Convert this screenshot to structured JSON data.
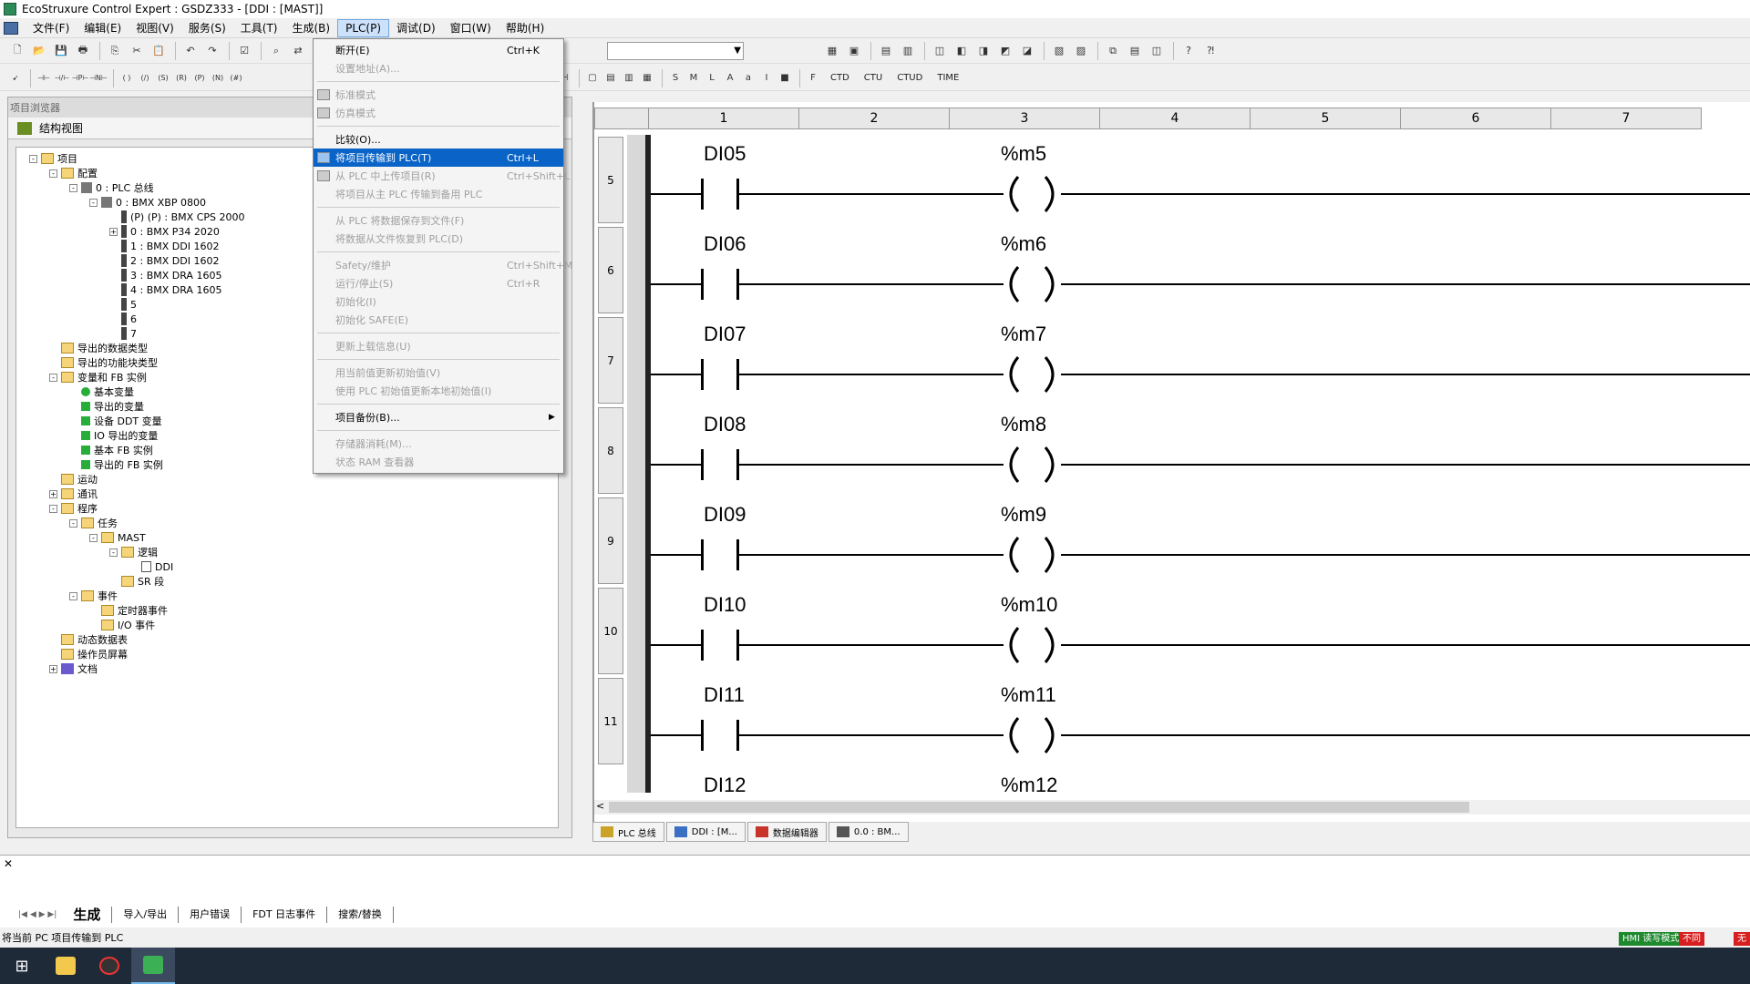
{
  "window": {
    "title": "EcoStruxure Control Expert : GSDZ333 - [DDI : [MAST]]"
  },
  "menubar": {
    "items": [
      "文件(F)",
      "编辑(E)",
      "视图(V)",
      "服务(S)",
      "工具(T)",
      "生成(B)",
      "PLC(P)",
      "调试(D)",
      "窗口(W)",
      "帮助(H)"
    ]
  },
  "toolbar2": {
    "blocks": [
      "CTD",
      "CTU",
      "CTUD",
      "TIME"
    ]
  },
  "browser": {
    "title": "项目浏览器",
    "view_tab": "结构视图",
    "tree": [
      {
        "label": "项目",
        "expand": "-",
        "indent": 0,
        "icon": "folder"
      },
      {
        "label": "配置",
        "expand": "-",
        "indent": 1,
        "icon": "folder"
      },
      {
        "label": "0 : PLC 总线",
        "expand": "-",
        "indent": 2,
        "icon": "rack"
      },
      {
        "label": "0 : BMX XBP 0800",
        "expand": "-",
        "indent": 3,
        "icon": "rack"
      },
      {
        "label": "(P) (P) : BMX CPS 2000",
        "expand": "",
        "indent": 4,
        "icon": "card"
      },
      {
        "label": "0 : BMX P34 2020",
        "expand": "+",
        "indent": 4,
        "icon": "card"
      },
      {
        "label": "1 : BMX DDI 1602",
        "expand": "",
        "indent": 4,
        "icon": "card"
      },
      {
        "label": "2 : BMX DDI 1602",
        "expand": "",
        "indent": 4,
        "icon": "card"
      },
      {
        "label": "3 : BMX DRA 1605",
        "expand": "",
        "indent": 4,
        "icon": "card"
      },
      {
        "label": "4 : BMX DRA 1605",
        "expand": "",
        "indent": 4,
        "icon": "card"
      },
      {
        "label": "5",
        "expand": "",
        "indent": 4,
        "icon": "card"
      },
      {
        "label": "6",
        "expand": "",
        "indent": 4,
        "icon": "card"
      },
      {
        "label": "7",
        "expand": "",
        "indent": 4,
        "icon": "card"
      },
      {
        "label": "导出的数据类型",
        "expand": "",
        "indent": 1,
        "icon": "folder"
      },
      {
        "label": "导出的功能块类型",
        "expand": "",
        "indent": 1,
        "icon": "folder"
      },
      {
        "label": "变量和 FB 实例",
        "expand": "-",
        "indent": 1,
        "icon": "folder"
      },
      {
        "label": "基本变量",
        "expand": "",
        "indent": 2,
        "icon": "green"
      },
      {
        "label": "导出的变量",
        "expand": "",
        "indent": 2,
        "icon": "greensq"
      },
      {
        "label": "设备 DDT 变量",
        "expand": "",
        "indent": 2,
        "icon": "greensq"
      },
      {
        "label": "IO 导出的变量",
        "expand": "",
        "indent": 2,
        "icon": "greensq"
      },
      {
        "label": "基本 FB 实例",
        "expand": "",
        "indent": 2,
        "icon": "greensq"
      },
      {
        "label": "导出的 FB 实例",
        "expand": "",
        "indent": 2,
        "icon": "greensq"
      },
      {
        "label": "运动",
        "expand": "",
        "indent": 1,
        "icon": "folder"
      },
      {
        "label": "通讯",
        "expand": "+",
        "indent": 1,
        "icon": "folder"
      },
      {
        "label": "程序",
        "expand": "-",
        "indent": 1,
        "icon": "folder"
      },
      {
        "label": "任务",
        "expand": "-",
        "indent": 2,
        "icon": "folder"
      },
      {
        "label": "MAST",
        "expand": "-",
        "indent": 3,
        "icon": "folder"
      },
      {
        "label": "逻辑",
        "expand": "-",
        "indent": 4,
        "icon": "folder"
      },
      {
        "label": "DDI",
        "expand": "",
        "indent": 5,
        "icon": "doc"
      },
      {
        "label": "SR 段",
        "expand": "",
        "indent": 4,
        "icon": "folder"
      },
      {
        "label": "事件",
        "expand": "-",
        "indent": 2,
        "icon": "folder"
      },
      {
        "label": "定时器事件",
        "expand": "",
        "indent": 3,
        "icon": "folder"
      },
      {
        "label": "I/O 事件",
        "expand": "",
        "indent": 3,
        "icon": "folder"
      },
      {
        "label": "动态数据表",
        "expand": "",
        "indent": 1,
        "icon": "folder"
      },
      {
        "label": "操作员屏幕",
        "expand": "",
        "indent": 1,
        "icon": "folder"
      },
      {
        "label": "文档",
        "expand": "+",
        "indent": 1,
        "icon": "book"
      }
    ]
  },
  "plc_menu": [
    {
      "label": "断开(E)",
      "accel": "Ctrl+K",
      "enabled": true
    },
    {
      "label": "设置地址(A)...",
      "accel": "",
      "enabled": false
    },
    {
      "sep": true
    },
    {
      "label": "标准模式",
      "accel": "",
      "enabled": false,
      "icon": true
    },
    {
      "label": "仿真模式",
      "accel": "",
      "enabled": false,
      "icon": true
    },
    {
      "sep": true
    },
    {
      "label": "比较(O)...",
      "accel": "",
      "enabled": true
    },
    {
      "label": "将项目传输到 PLC(T)",
      "accel": "Ctrl+L",
      "enabled": true,
      "selected": true,
      "icon": true
    },
    {
      "label": "从 PLC 中上传项目(R)",
      "accel": "Ctrl+Shift+L",
      "enabled": false,
      "icon": true
    },
    {
      "label": "将项目从主 PLC 传输到备用 PLC",
      "accel": "",
      "enabled": false
    },
    {
      "sep": true
    },
    {
      "label": "从 PLC 将数据保存到文件(F)",
      "accel": "",
      "enabled": false
    },
    {
      "label": "将数据从文件恢复到 PLC(D)",
      "accel": "",
      "enabled": false
    },
    {
      "sep": true
    },
    {
      "label": "Safety/维护",
      "accel": "Ctrl+Shift+M",
      "enabled": false
    },
    {
      "label": "运行/停止(S)",
      "accel": "Ctrl+R",
      "enabled": false
    },
    {
      "label": "初始化(I)",
      "accel": "",
      "enabled": false
    },
    {
      "label": "初始化 SAFE(E)",
      "accel": "",
      "enabled": false
    },
    {
      "sep": true
    },
    {
      "label": "更新上载信息(U)",
      "accel": "",
      "enabled": false
    },
    {
      "sep": true
    },
    {
      "label": "用当前值更新初始值(V)",
      "accel": "",
      "enabled": false
    },
    {
      "label": "使用 PLC 初始值更新本地初始值(I)",
      "accel": "",
      "enabled": false
    },
    {
      "sep": true
    },
    {
      "label": "项目备份(B)...",
      "accel": "",
      "enabled": true,
      "submenu": true
    },
    {
      "sep": true
    },
    {
      "label": "存储器消耗(M)...",
      "accel": "",
      "enabled": false
    },
    {
      "label": "状态 RAM 查看器",
      "accel": "",
      "enabled": false
    }
  ],
  "ladder": {
    "columns": [
      "1",
      "2",
      "3",
      "4",
      "5",
      "6",
      "7"
    ],
    "rungs": [
      {
        "row": "5",
        "input": "DI05",
        "output": "%m5"
      },
      {
        "row": "6",
        "input": "DI06",
        "output": "%m6"
      },
      {
        "row": "7",
        "input": "DI07",
        "output": "%m7"
      },
      {
        "row": "8",
        "input": "DI08",
        "output": "%m8"
      },
      {
        "row": "9",
        "input": "DI09",
        "output": "%m9"
      },
      {
        "row": "10",
        "input": "DI10",
        "output": "%m10"
      },
      {
        "row": "11",
        "input": "DI11",
        "output": "%m11"
      },
      {
        "row": "",
        "input": "DI12",
        "output": "%m12"
      }
    ]
  },
  "doc_tabs": [
    "PLC 总线",
    "DDI : [M...",
    "数据编辑器",
    "0.0 : BM..."
  ],
  "output_tabs": [
    "生成",
    "导入/导出",
    "用户错误",
    "FDT 日志事件",
    "搜索/替换"
  ],
  "status": {
    "message": "将当前 PC 项目传输到 PLC",
    "hmi": "HMI 读写模式",
    "diff": "不同",
    "end": "无"
  },
  "colors": {
    "menu_selected": "#0a64c8",
    "hmi_badge": "#1e8a2e",
    "diff_badge": "#d81e1e"
  }
}
